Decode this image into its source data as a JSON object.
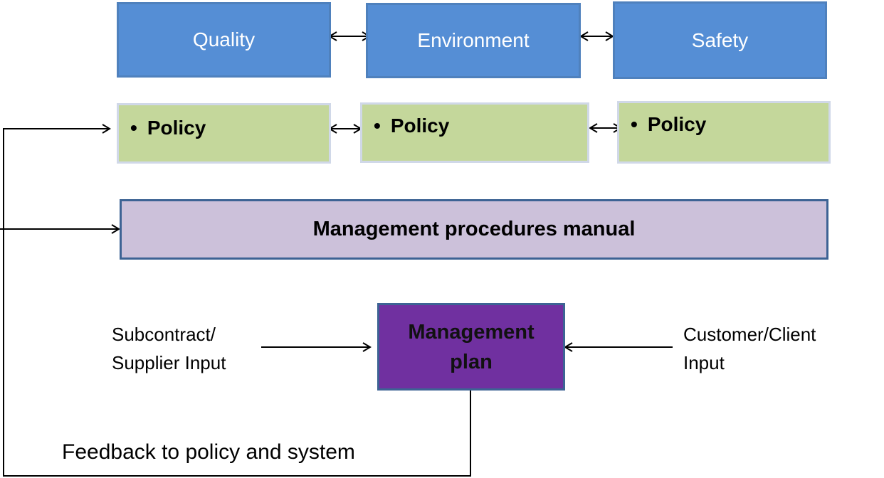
{
  "areas": [
    {
      "title": "Quality",
      "policy": "Policy"
    },
    {
      "title": "Environment",
      "policy": "Policy"
    },
    {
      "title": "Safety",
      "policy": "Policy"
    }
  ],
  "bullet": "•",
  "manual": "Management procedures manual",
  "plan": {
    "line1": "Management",
    "line2": "plan"
  },
  "inputs": {
    "left": {
      "line1": "Subcontract/",
      "line2": "Supplier Input"
    },
    "right": {
      "line1": "Customer/Client",
      "line2": "Input"
    }
  },
  "feedback": "Feedback to policy and system",
  "colors": {
    "area": "#558ed5",
    "policy": "#c4d79b",
    "manual": "#ccc1da",
    "plan": "#7030a0",
    "border": "#3d6394"
  }
}
